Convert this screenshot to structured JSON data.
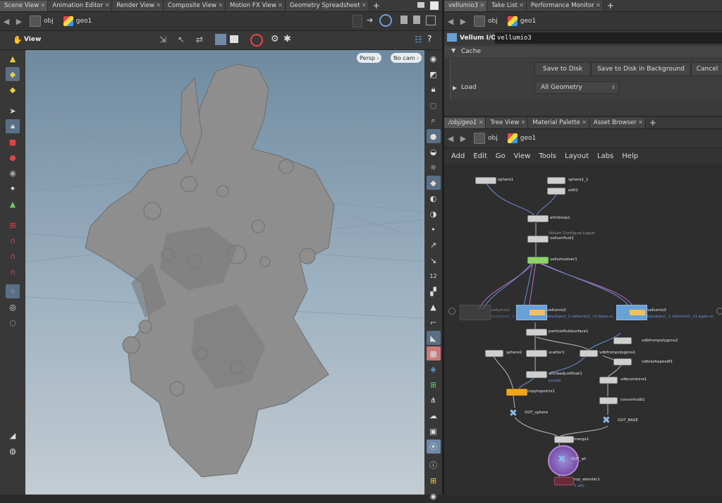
{
  "left_tabs": [
    "Scene View",
    "Animation Editor",
    "Render View",
    "Composite View",
    "Motion FX View",
    "Geometry Spreadsheet"
  ],
  "left_path": {
    "root": "obj",
    "node": "geo1"
  },
  "viewport": {
    "label": "View",
    "persp": "Persp -",
    "cam": "No cam -"
  },
  "right_top_tabs": [
    "vellumio3",
    "Take List",
    "Performance Monitor"
  ],
  "right_top_path": {
    "root": "obj",
    "node": "geo1"
  },
  "params": {
    "node_type": "Vellum I/O",
    "node_name": "vellumio3",
    "cache_label": "Cache",
    "save_disk": "Save to Disk",
    "save_background": "Save to Disk in Background",
    "cancel": "Cancel",
    "load_label": "Load",
    "load_value": "All Geometry"
  },
  "net_tabs": [
    "/obj/geo1",
    "Tree View",
    "Material Palette",
    "Asset Browser"
  ],
  "net_path": {
    "root": "obj",
    "node": "geo1"
  },
  "net_menu": [
    "Add",
    "Edit",
    "Go",
    "View",
    "Tools",
    "Layout",
    "Labs",
    "Help"
  ],
  "nodes": {
    "sphere1": "sphere1",
    "sphere1_1": "sphere1_1",
    "edit1": "edit1",
    "attribvop1": "attribvop1",
    "vellumfluid_comment": "Vellum Configure Liquid",
    "vellumfluid1": "vellumfluid1",
    "vellumsolver1": "vellumsolver1",
    "vellumio_left": "vellumio1",
    "vellumio_left_file": "keyobject_1.vellumio1...",
    "vellumio2": "vellumio2",
    "vellumio2_file": "keyobject_1.vellumio1_v1.bgeo.sc",
    "vellumio3": "vellumio3",
    "vellumio3_file": "keyobject_1.vellumio1_v1.bgeo.sc",
    "particlefluidsurface1": "particlefluidsurface1",
    "vdbfrompolygons2": "vdbfrompolygons2",
    "sphere2": "sphere2",
    "scatter1": "scatter1",
    "vdbfrompolygons1": "vdbfrompolygons1",
    "vdbreshapesdf1": "vdbreshapesdf1",
    "attribadjustfloat1": "attribadjustfloat1",
    "attribadjustfloat1_sub": "pscale",
    "vdbcombine1": "vdbcombine1",
    "copytopoints1": "copytopoints1",
    "convertvdb1": "convertvdb1",
    "out_sphere": "OUT_sphere",
    "out_base": "OUT_BASE",
    "merge1": "merge1",
    "out_all": "OUT_all",
    "rop_alembic1": "rop_alembic1",
    "rop_alembic1_sub": "1.abc"
  },
  "colors": {
    "viewport_top": "#6f8aa0",
    "viewport_bottom": "#c3ccd2",
    "network_bg": "#2e2e2e",
    "solver_green": "#8fd36a",
    "copy_orange": "#f0a420",
    "out_purple": "#7a4fa8"
  }
}
